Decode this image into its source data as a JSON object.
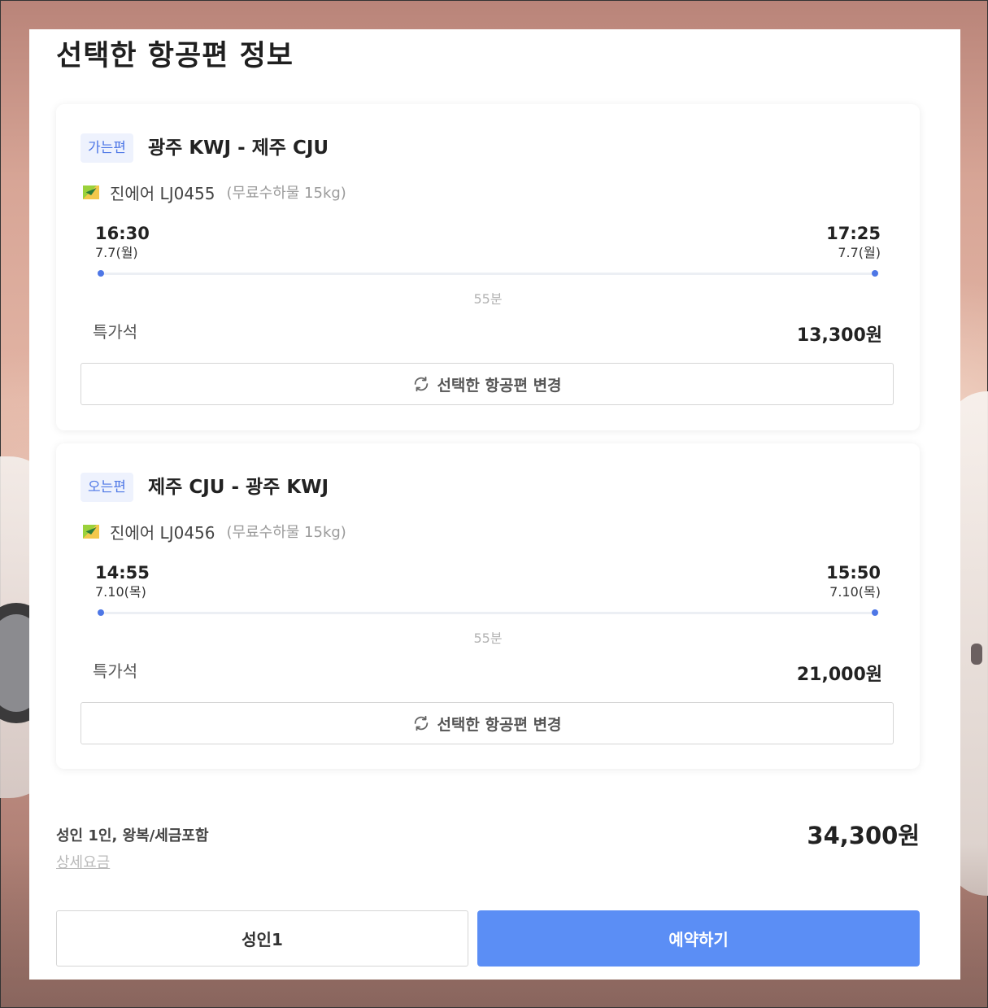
{
  "page_title": "선택한 항공편 정보",
  "colors": {
    "accent": "#5b8ef5",
    "badge_text": "#4e77e6",
    "badge_bg": "#eef2fd"
  },
  "flights": [
    {
      "badge": "가는편",
      "route": "광주 KWJ - 제주 CJU",
      "airline": "진에어 LJ0455",
      "baggage": "(무료수하물 15kg)",
      "departure": {
        "time": "16:30",
        "date": "7.7(월)"
      },
      "arrival": {
        "time": "17:25",
        "date": "7.7(월)"
      },
      "duration": "55분",
      "seat_class": "특가석",
      "price": "13,300원",
      "change_label": "선택한 항공편 변경",
      "airline_icon": "jinair-logo-icon"
    },
    {
      "badge": "오는편",
      "route": "제주 CJU - 광주 KWJ",
      "airline": "진에어 LJ0456",
      "baggage": "(무료수하물 15kg)",
      "departure": {
        "time": "14:55",
        "date": "7.10(목)"
      },
      "arrival": {
        "time": "15:50",
        "date": "7.10(목)"
      },
      "duration": "55분",
      "seat_class": "특가석",
      "price": "21,000원",
      "change_label": "선택한 항공편 변경",
      "airline_icon": "jinair-logo-icon"
    }
  ],
  "summary": {
    "label": "성인 1인, 왕복/세금포함",
    "detail_link": "상세요금",
    "total": "34,300원"
  },
  "actions": {
    "passengers": "성인1",
    "book": "예약하기"
  }
}
